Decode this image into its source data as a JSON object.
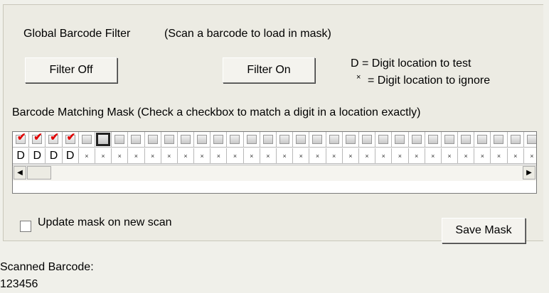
{
  "filter": {
    "title": "Global Barcode Filter",
    "hint": "(Scan a barcode to load in mask)",
    "off_label": "Filter Off",
    "on_label": "Filter On",
    "legend_test": "D = Digit location to test",
    "legend_ignore_symbol": "×",
    "legend_ignore": "= Digit location to ignore"
  },
  "mask": {
    "title": "Barcode Matching Mask (Check a checkbox to match a digit in a location exactly)",
    "checked": [
      true,
      true,
      true,
      true,
      false,
      false,
      false,
      false,
      false,
      false,
      false,
      false,
      false,
      false,
      false,
      false,
      false,
      false,
      false,
      false,
      false,
      false,
      false,
      false,
      false,
      false,
      false,
      false,
      false,
      false,
      false,
      false
    ],
    "digits": [
      "D",
      "D",
      "D",
      "D",
      "×",
      "×",
      "×",
      "×",
      "×",
      "×",
      "×",
      "×",
      "×",
      "×",
      "×",
      "×",
      "×",
      "×",
      "×",
      "×",
      "×",
      "×",
      "×",
      "×",
      "×",
      "×",
      "×",
      "×",
      "×",
      "×",
      "×",
      "×"
    ]
  },
  "options": {
    "update_label": "Update mask on new scan",
    "update_checked": false,
    "save_label": "Save Mask"
  },
  "scanned": {
    "label": "Scanned Barcode:",
    "value": "123456"
  }
}
